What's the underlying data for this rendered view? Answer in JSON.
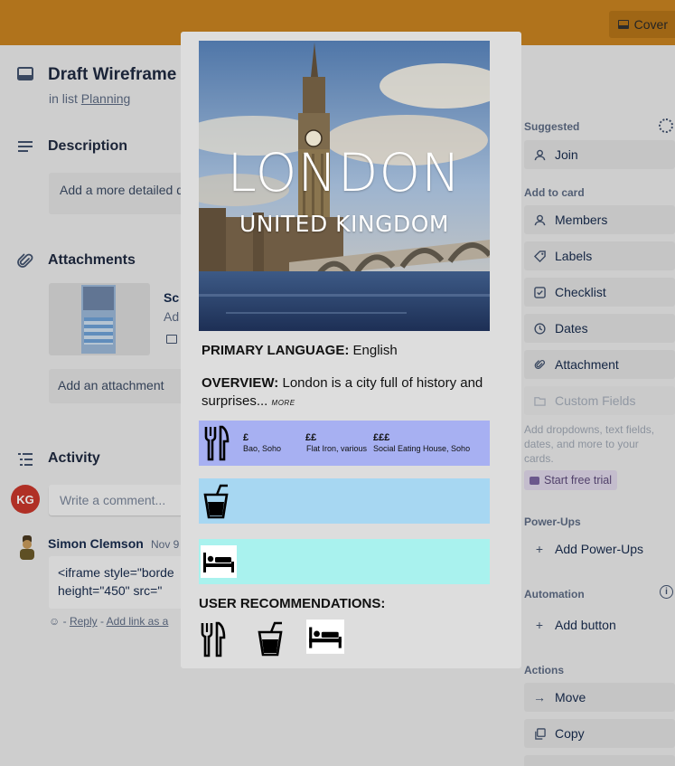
{
  "header": {
    "cover_label": "Cover"
  },
  "card": {
    "title": "Draft Wireframe",
    "list_prefix": "in list",
    "list_name": "Planning",
    "description": {
      "heading": "Description",
      "placeholder": "Add a more detailed d"
    },
    "attachments": {
      "heading": "Attachments",
      "item_name": "Sc",
      "item_meta": "Ad",
      "add_label": "Add an attachment"
    },
    "activity": {
      "heading": "Activity",
      "avatar_initials": "KG",
      "comment_placeholder": "Write a comment...",
      "comment": {
        "author": "Simon Clemson",
        "date": "Nov 9",
        "line1": "<iframe style=\"borde",
        "line2": "height=\"450\" src=\"",
        "reply": "Reply",
        "add_link": "Add link as a"
      }
    }
  },
  "sidebar": {
    "suggested_label": "Suggested",
    "join": "Join",
    "add_to_card_label": "Add to card",
    "members": "Members",
    "labels": "Labels",
    "checklist": "Checklist",
    "dates": "Dates",
    "attachment": "Attachment",
    "custom_fields": "Custom Fields",
    "custom_fields_help": "Add dropdowns, text fields, dates, and more to your cards.",
    "trial": "Start free trial",
    "powerups_label": "Power-Ups",
    "add_powerups": "Add Power-Ups",
    "automation_label": "Automation",
    "add_button": "Add button",
    "actions_label": "Actions",
    "move": "Move",
    "copy": "Copy"
  },
  "modal": {
    "city": "LONDON",
    "country": "UNITED KINGDOM",
    "primary_language_label": "PRIMARY LANGUAGE:",
    "primary_language_value": "English",
    "overview_label": "OVERVIEW:",
    "overview_text_1": "London is a city full of history and",
    "overview_text_2": "surprises...",
    "more": "MORE",
    "food": [
      {
        "price": "£",
        "place": "Bao, Soho"
      },
      {
        "price": "££",
        "place": "Flat Iron, various"
      },
      {
        "price": "£££",
        "place": "Social Eating House, Soho"
      }
    ],
    "rec_title": "USER RECOMMENDATIONS:"
  },
  "colors": {
    "header_band": "#c98320",
    "food_bar": "#a7b0f2",
    "drink_bar": "#a7d7f2",
    "stay_bar": "#a9f2ee",
    "avatar_kg": "#c9372c"
  },
  "icons": [
    "cover-icon",
    "card-icon",
    "description-icon",
    "paperclip-icon",
    "activity-icon",
    "user-icon",
    "tag-icon",
    "checklist-icon",
    "clock-icon",
    "paperclip-icon",
    "custom-fields-icon",
    "gear-icon",
    "info-icon",
    "plus-icon",
    "arrow-right-icon",
    "copy-icon",
    "cutlery-icon",
    "drink-icon",
    "bed-icon"
  ]
}
